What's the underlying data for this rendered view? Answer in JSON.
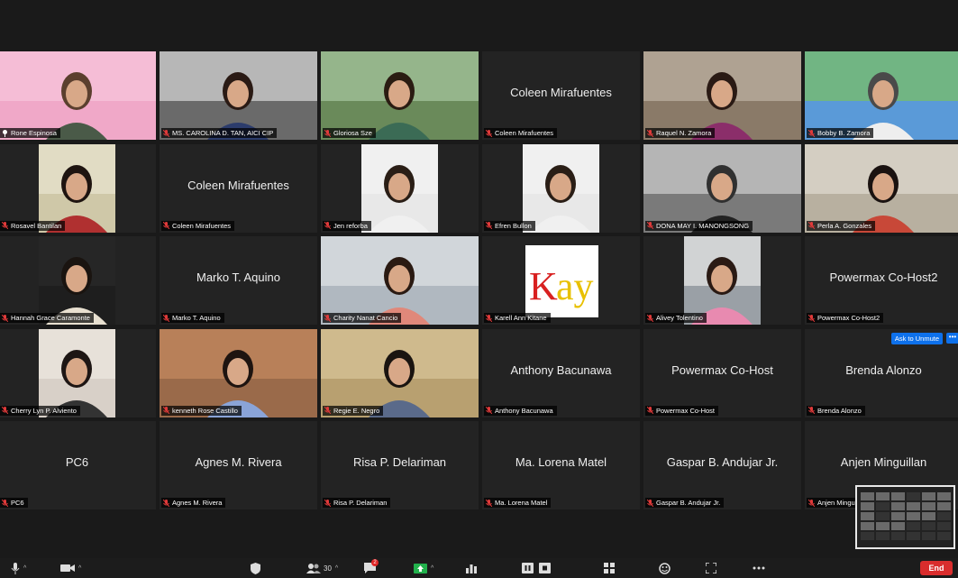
{
  "participants": [
    {
      "name": "Rone Espinosa",
      "video": true,
      "active": true,
      "scene": "pink",
      "icon": "pin-icon"
    },
    {
      "name": "MS. CAROLINA D. TAN, AICI CIP",
      "video": true,
      "scene": "office"
    },
    {
      "name": "Gloriosa Sze",
      "video": true,
      "scene": "green"
    },
    {
      "name": "Coleen Mirafuentes",
      "video": false,
      "display": "Coleen Mirafuentes"
    },
    {
      "name": "Raquel N. Zamora",
      "video": true,
      "scene": "room"
    },
    {
      "name": "Bobby B. Zamora",
      "video": true,
      "scene": "golf"
    },
    {
      "name": "Rosavel Bantilan",
      "video": true,
      "scene": "narrow"
    },
    {
      "name": "Coleen Mirafuentes",
      "video": false,
      "display": "Coleen Mirafuentes"
    },
    {
      "name": "Jen reforba",
      "video": true,
      "scene": "narrow-white"
    },
    {
      "name": "Efren Bullon",
      "video": true,
      "scene": "narrow-white"
    },
    {
      "name": "DONA MAY I. MANONGSONG",
      "video": true,
      "scene": "classroom"
    },
    {
      "name": "Perla A. Gonzales",
      "video": true,
      "scene": "papers"
    },
    {
      "name": "Hannah Grace Caramonte",
      "video": true,
      "scene": "dark"
    },
    {
      "name": "Marko T. Aquino",
      "video": false,
      "display": "Marko T. Aquino"
    },
    {
      "name": "Charity Nanat Cancio",
      "video": true,
      "scene": "office2"
    },
    {
      "name": "Karell Ann Kitane",
      "video": true,
      "scene": "kay",
      "logo": "Kay"
    },
    {
      "name": "Alivey Tolentino",
      "video": true,
      "scene": "car"
    },
    {
      "name": "Powermax Co-Host2",
      "video": false,
      "display": "Powermax Co-Host2"
    },
    {
      "name": "Cherry Lyn P. Alviento",
      "video": true,
      "scene": "store"
    },
    {
      "name": "kenneth Rose Castillo",
      "video": true,
      "scene": "brown"
    },
    {
      "name": "Regie E. Negro",
      "video": true,
      "scene": "boxes"
    },
    {
      "name": "Anthony Bacunawa",
      "video": false,
      "display": "Anthony Bacunawa"
    },
    {
      "name": "Powermax Co-Host",
      "video": false,
      "display": "Powermax Co-Host"
    },
    {
      "name": "Brenda Alonzo",
      "video": false,
      "display": "Brenda Alonzo",
      "ask": "Ask to Unmute",
      "more": "•••"
    },
    {
      "name": "PC6",
      "video": false,
      "display": "PC6"
    },
    {
      "name": "Agnes M. Rivera",
      "video": false,
      "display": "Agnes M. Rivera"
    },
    {
      "name": "Risa P. Delariman",
      "video": false,
      "display": "Risa P. Delariman"
    },
    {
      "name": "Ma. Lorena Matel",
      "video": false,
      "display": "Ma. Lorena Matel"
    },
    {
      "name": "Gaspar B. Andujar Jr.",
      "video": false,
      "display": "Gaspar B. Andujar Jr."
    },
    {
      "name": "Anjen Minguillan",
      "video": false,
      "display": "Anjen Minguillan",
      "namebar_text": "Anjen Mingu"
    }
  ],
  "toolbar": {
    "participants_count": "30",
    "chat_badge": "2",
    "end_label": "End"
  },
  "colors": {
    "accent": "#7ec850",
    "end": "#d92d2d",
    "ask": "#0e71eb"
  }
}
